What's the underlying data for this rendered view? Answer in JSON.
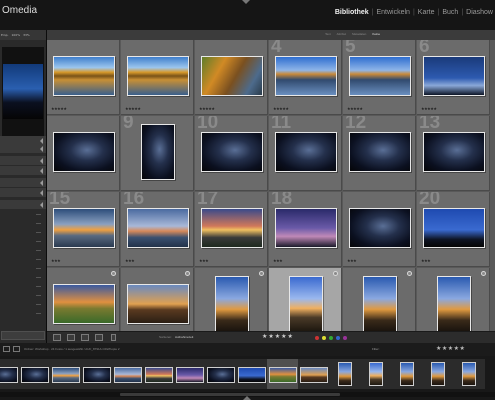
{
  "app": {
    "logo": "Omedia",
    "logo_sub": "",
    "modules": [
      {
        "label": "Bibliothek",
        "active": true
      },
      {
        "label": "Entwickeln",
        "active": false
      },
      {
        "label": "Karte",
        "active": false
      },
      {
        "label": "Buch",
        "active": false
      },
      {
        "label": "Diashow",
        "active": false
      }
    ]
  },
  "left_panel": {
    "navigator_tabs": [
      "Einp.",
      "100%",
      "33%"
    ],
    "import_button": ""
  },
  "filter_bar": {
    "title": "",
    "options": [
      {
        "label": "Text",
        "active": false
      },
      {
        "label": "Attribut",
        "active": false
      },
      {
        "label": "Metadaten",
        "active": false
      },
      {
        "label": "Keine",
        "active": true
      }
    ]
  },
  "grid": {
    "rows": [
      [
        {
          "num": "",
          "thumb": "autumn-lake-reflection",
          "stars": "★★★★★",
          "orientation": "landscape"
        },
        {
          "num": "",
          "thumb": "autumn-lake-reflection",
          "stars": "★★★★★",
          "orientation": "landscape"
        },
        {
          "num": "",
          "thumb": "autumn-forest-river",
          "stars": "★★★★★",
          "orientation": "landscape"
        },
        {
          "num": "4",
          "thumb": "autumn-lake-blue-sky",
          "stars": "★★★★★",
          "orientation": "landscape"
        },
        {
          "num": "5",
          "thumb": "autumn-lake-blue-sky",
          "stars": "★★★★★",
          "orientation": "landscape"
        },
        {
          "num": "6",
          "thumb": "winter-trees-night",
          "stars": "★★★★★",
          "orientation": "landscape"
        }
      ],
      [
        {
          "num": "",
          "thumb": "milky-way-dark",
          "stars": "",
          "orientation": "landscape"
        },
        {
          "num": "9",
          "thumb": "milky-way-dark",
          "stars": "",
          "orientation": "portrait"
        },
        {
          "num": "10",
          "thumb": "milky-way-dark",
          "stars": "",
          "orientation": "landscape"
        },
        {
          "num": "11",
          "thumb": "milky-way-dark",
          "stars": "",
          "orientation": "landscape"
        },
        {
          "num": "12",
          "thumb": "milky-way-dark",
          "stars": "",
          "orientation": "landscape"
        },
        {
          "num": "13",
          "thumb": "milky-way-dark",
          "stars": "",
          "orientation": "landscape"
        }
      ],
      [
        {
          "num": "15",
          "thumb": "sea-sunset",
          "stars": "★★★",
          "orientation": "landscape"
        },
        {
          "num": "16",
          "thumb": "sea-dusk",
          "stars": "★★★",
          "orientation": "landscape"
        },
        {
          "num": "17",
          "thumb": "coast-sunset",
          "stars": "★★★",
          "orientation": "landscape"
        },
        {
          "num": "18",
          "thumb": "milky-way-violet",
          "stars": "★★★",
          "orientation": "landscape"
        },
        {
          "num": "",
          "thumb": "milky-way-dark",
          "stars": "★★★",
          "orientation": "landscape"
        },
        {
          "num": "20",
          "thumb": "night-trees-blue",
          "stars": "★★★",
          "orientation": "landscape"
        }
      ],
      [
        {
          "num": "",
          "thumb": "meadow-sunset",
          "stars": "★★★★★",
          "orientation": "landscape",
          "badge": true
        },
        {
          "num": "",
          "thumb": "rock-sunset",
          "stars": "★★★★★",
          "orientation": "landscape",
          "badge": true
        },
        {
          "num": "",
          "thumb": "rock-portrait",
          "stars": "★★★★★",
          "orientation": "portrait",
          "badge": true
        },
        {
          "num": "",
          "thumb": "rock-portrait-blue",
          "stars": "★★★★★",
          "orientation": "portrait",
          "badge": true,
          "selected": true
        },
        {
          "num": "",
          "thumb": "rock-portrait",
          "stars": "★★★★★",
          "orientation": "portrait",
          "badge": true
        },
        {
          "num": "",
          "thumb": "rock-portrait",
          "stars": "★★★★★",
          "orientation": "portrait",
          "badge": true
        }
      ]
    ]
  },
  "toolbar": {
    "sort_label": "Sortieren:",
    "sort_value": "Aufnahmezeit",
    "stars": "★★★★★",
    "colors": [
      "#c33",
      "#dd3",
      "#3a3",
      "#36c",
      "#939"
    ]
  },
  "filmstrip": {
    "path": "Ordner: Workshop · 24 Fotos / 1 ausgewählt / AUF_8791A.CR2/Kopie 2",
    "filter_label": "Filter:",
    "stars": "★★★★★",
    "thumbs": [
      "milky-way-dark",
      "milky-way-dark",
      "sea-sunset",
      "milky-way-dark",
      "sea-dusk",
      "coast-sunset",
      "milky-way-violet",
      "milky-way-dark",
      "night-trees-blue",
      "meadow-sunset",
      "rock-sunset",
      "rock-portrait",
      "rock-portrait-blue",
      "rock-portrait",
      "rock-portrait",
      "rock-portrait"
    ],
    "selected_index": 9
  }
}
